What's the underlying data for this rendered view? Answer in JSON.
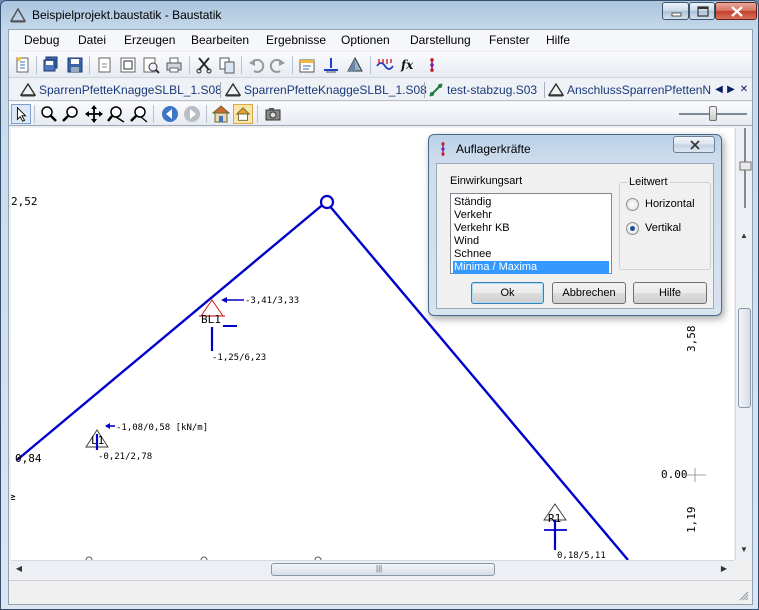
{
  "window": {
    "title": "Beispielprojekt.baustatik - Baustatik",
    "controls": [
      "minimize",
      "maximize",
      "close"
    ]
  },
  "menu": {
    "items": [
      "Debug",
      "Datei",
      "Erzeugen",
      "Bearbeiten",
      "Ergebnisse",
      "Optionen",
      "Darstellung",
      "Fenster",
      "Hilfe"
    ]
  },
  "toolbar": {
    "icons": [
      "new-icon",
      "save-all-icon",
      "save-icon",
      "page-icon",
      "print-preview-icon",
      "zoom-page-icon",
      "printer-icon",
      "cut-icon",
      "copy-icon",
      "undo-icon",
      "redo-icon",
      "properties-icon",
      "support-icon",
      "element-icon",
      "load-icon",
      "formula-icon",
      "reaction-icon"
    ],
    "formula_glyph": "fx"
  },
  "tabs": [
    {
      "label": "SparrenPfetteKnaggeSLBL_1.S08",
      "icon": "roof-icon"
    },
    {
      "label": "SparrenPfetteKnaggeSLBL_1.S08",
      "icon": "roof-icon"
    },
    {
      "label": "test-stabzug.S03",
      "icon": "frame-icon"
    },
    {
      "label": "AnschlussSparrenPfettenN",
      "icon": "roof-icon"
    }
  ],
  "tab_nav": {
    "prev": "◀",
    "next": "▶",
    "close": "✕"
  },
  "viewtools": {
    "icons": [
      "pointer-icon",
      "zoom-icon",
      "zoom-out-icon",
      "pan-icon",
      "zoom-window-icon",
      "zoom-all-icon",
      "back-icon",
      "forward-icon",
      "house-lock-icon",
      "house-icon",
      "camera-icon"
    ]
  },
  "drawing": {
    "dim_left": "2,52",
    "dim_left_bottom": "0,84",
    "dim_right_top": "3,58",
    "dim_right_zero": "0.00",
    "dim_right_bottom": "1,19",
    "support_bl1": "BL1",
    "support_l1": "L1",
    "support_r1": "R1",
    "load_bl1_h": "-3,41/3,33",
    "load_bl1_v": "-1,25/6,23",
    "load_l1_h": "-1,08/0,58 [kN/m]",
    "load_l1_v": "-0,21/2,78",
    "load_r1_v": "0,18/5,11",
    "stray_left": "≥"
  },
  "scrollbar": {
    "up": "▲",
    "down": "▼",
    "left": "◀",
    "right": "▶",
    "grip": "|||"
  },
  "dialog": {
    "title": "Auflagerkräfte",
    "close_glyph": "✕",
    "list_label": "Einwirkungsart",
    "list_items": [
      "Ständig",
      "Verkehr",
      "Verkehr KB",
      "Wind",
      "Schnee",
      "Minima / Maxima"
    ],
    "selected_index": 5,
    "group_label": "Leitwert",
    "radio_horizontal": "Horizontal",
    "radio_vertical": "Vertikal",
    "radio_selected": "Vertikal",
    "btn_ok": "Ok",
    "btn_cancel": "Abbrechen",
    "btn_help": "Hilfe"
  },
  "colors": {
    "structure": "#0000cc",
    "support_marker": "#cc0000",
    "selection": "#3399ff"
  }
}
